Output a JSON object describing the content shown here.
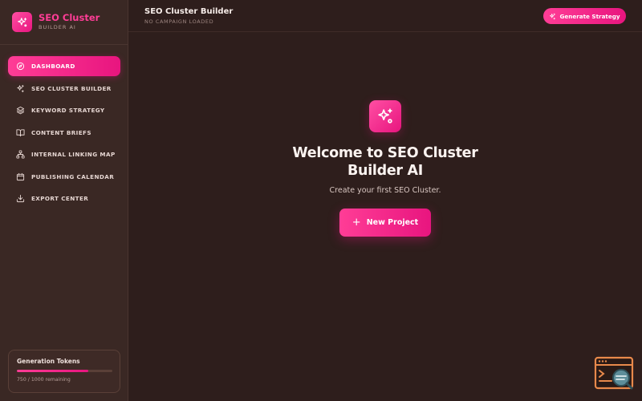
{
  "brand": {
    "name": "SEO Cluster",
    "subtitle": "BUILDER AI"
  },
  "sidebar": {
    "items": [
      {
        "label": "DASHBOARD",
        "icon": "compass-icon",
        "active": true
      },
      {
        "label": "SEO CLUSTER BUILDER",
        "icon": "sparkles-icon",
        "active": false
      },
      {
        "label": "KEYWORD STRATEGY",
        "icon": "layers-icon",
        "active": false
      },
      {
        "label": "CONTENT BRIEFS",
        "icon": "book-open-icon",
        "active": false
      },
      {
        "label": "INTERNAL LINKING MAP",
        "icon": "network-icon",
        "active": false
      },
      {
        "label": "PUBLISHING CALENDAR",
        "icon": "calendar-icon",
        "active": false
      },
      {
        "label": "EXPORT CENTER",
        "icon": "download-icon",
        "active": false
      }
    ]
  },
  "tokens": {
    "title": "Generation Tokens",
    "remaining_text": "750 / 1000 remaining",
    "fraction": 0.75
  },
  "header": {
    "title": "SEO Cluster Builder",
    "status": "NO CAMPAIGN LOADED",
    "generate_label": "Generate Strategy"
  },
  "main": {
    "welcome_title": "Welcome to SEO Cluster Builder AI",
    "subtitle": "Create your first SEO Cluster.",
    "new_project_label": "New Project"
  },
  "colors": {
    "accent": "#ff3d96",
    "accent_dark": "#e8157f",
    "background": "#2e1e1c",
    "sidebar": "#3a2824"
  }
}
